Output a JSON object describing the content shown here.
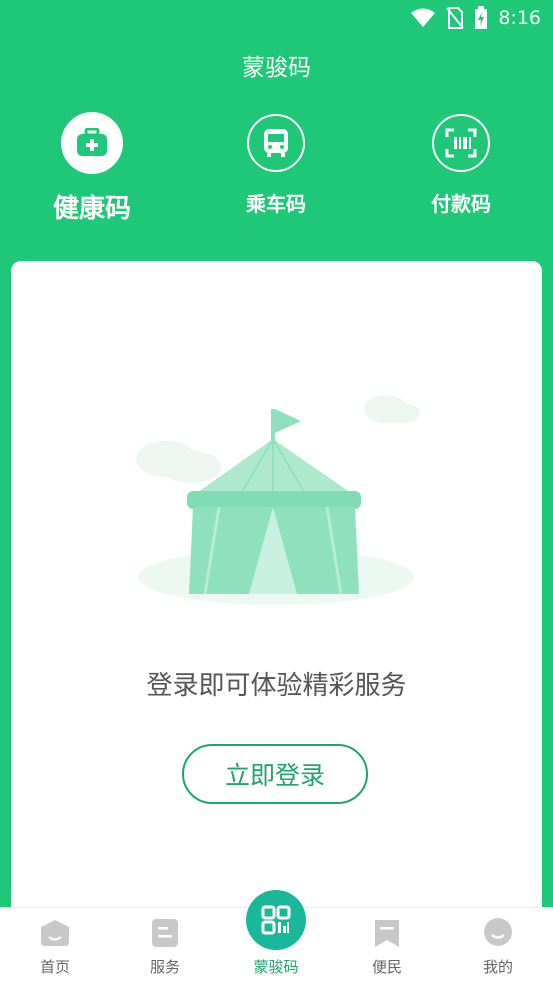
{
  "status_bar": {
    "time": "8:16"
  },
  "header": {
    "title": "蒙骏码"
  },
  "tabs": [
    {
      "label": "健康码",
      "icon": "medical-kit-icon",
      "active": true
    },
    {
      "label": "乘车码",
      "icon": "bus-icon",
      "active": false
    },
    {
      "label": "付款码",
      "icon": "barcode-scan-icon",
      "active": false
    }
  ],
  "card": {
    "illustration": "tent-empty-illustration",
    "prompt": "登录即可体验精彩服务",
    "login_button": "立即登录"
  },
  "bottom_nav": [
    {
      "label": "首页",
      "icon": "home-icon"
    },
    {
      "label": "服务",
      "icon": "service-icon"
    },
    {
      "label": "蒙骏码",
      "icon": "qr-code-icon",
      "active": true
    },
    {
      "label": "便民",
      "icon": "bookmark-icon"
    },
    {
      "label": "我的",
      "icon": "profile-icon"
    }
  ],
  "colors": {
    "brand_green": "#1fc878",
    "accent_teal": "#19b89a",
    "text_gray": "#555555"
  }
}
